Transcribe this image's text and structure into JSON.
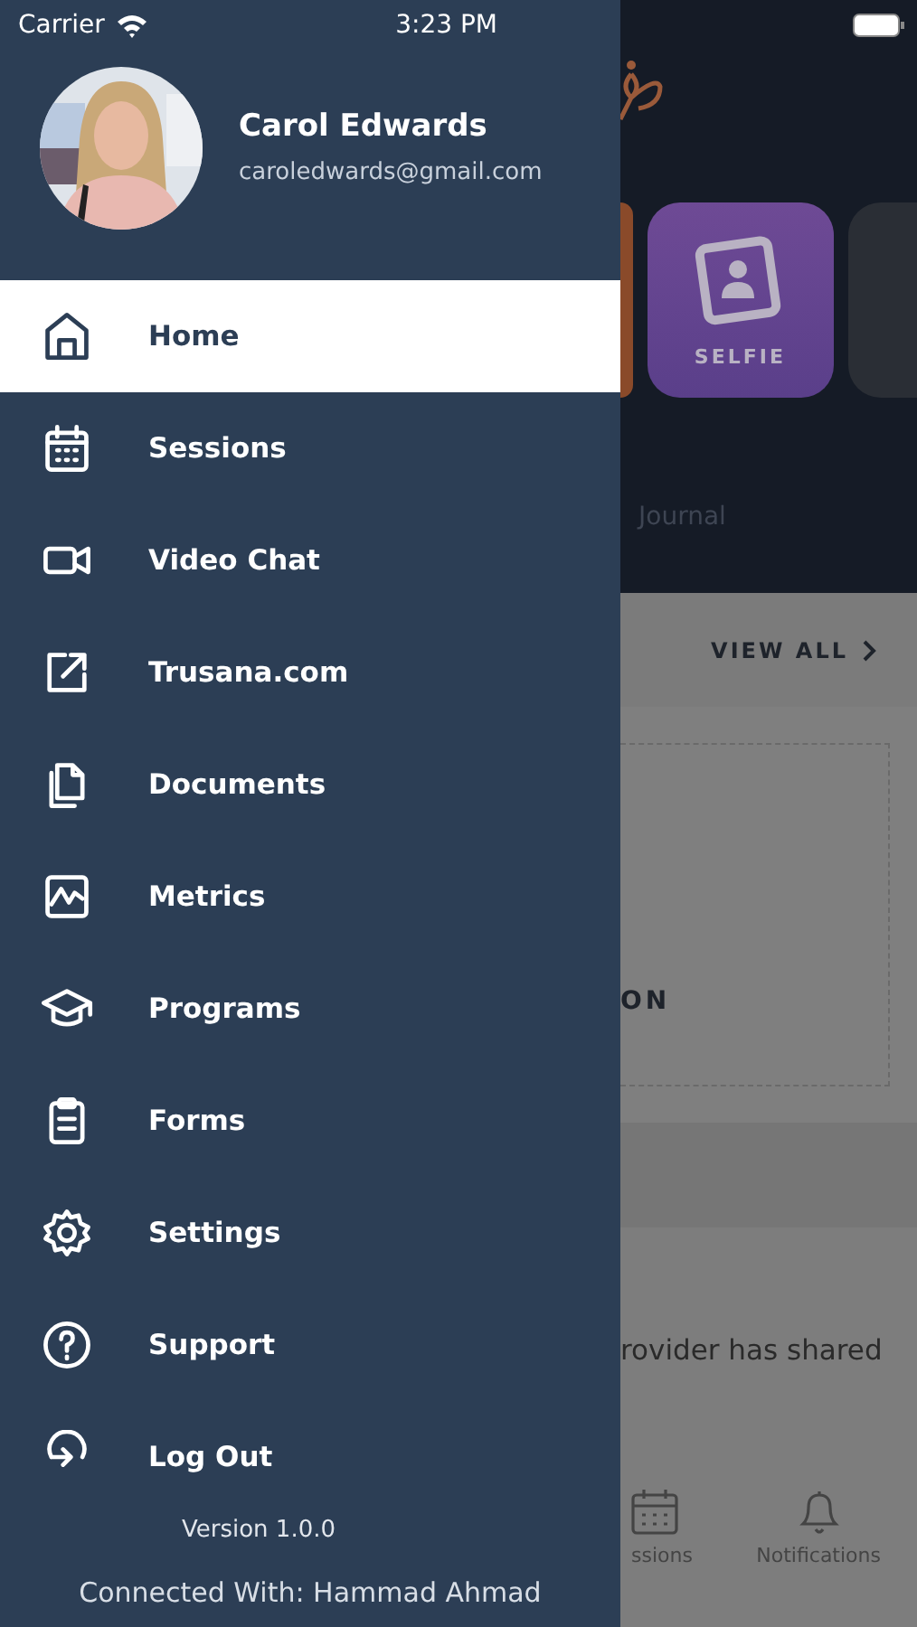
{
  "status_bar": {
    "carrier": "Carrier",
    "time": "3:23 PM"
  },
  "drawer": {
    "user": {
      "name": "Carol Edwards",
      "email": "caroledwards@gmail.com"
    },
    "menu": [
      {
        "label": "Home",
        "selected": true
      },
      {
        "label": "Sessions",
        "selected": false
      },
      {
        "label": "Video Chat",
        "selected": false
      },
      {
        "label": "Trusana.com",
        "selected": false
      },
      {
        "label": "Documents",
        "selected": false
      },
      {
        "label": "Metrics",
        "selected": false
      },
      {
        "label": "Programs",
        "selected": false
      },
      {
        "label": "Forms",
        "selected": false
      },
      {
        "label": "Settings",
        "selected": false
      },
      {
        "label": "Support",
        "selected": false
      },
      {
        "label": "Log Out",
        "selected": false
      }
    ],
    "version": "Version 1.0.0",
    "connected": "Connected With: Hammad Ahmad"
  },
  "background": {
    "tile": {
      "label": "SELFIE"
    },
    "tab": "Journal",
    "section": {
      "link": "VIEW ALL"
    },
    "card": {
      "text": "ON"
    },
    "body": "rovider has shared",
    "tab_bar": [
      {
        "label": "ssions"
      },
      {
        "label": "Notifications"
      }
    ]
  }
}
